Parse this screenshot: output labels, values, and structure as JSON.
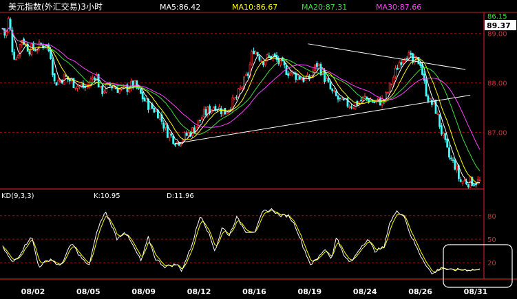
{
  "chart_data": [
    {
      "type": "candlestick",
      "title": "美元指数(外汇交易)3小时",
      "moving_averages": [
        {
          "name": "MA5",
          "value": "86.42",
          "color": "#ffffff"
        },
        {
          "name": "MA10",
          "value": "86.67",
          "color": "#ffff00"
        },
        {
          "name": "MA20",
          "value": "87.31",
          "color": "#40e040"
        },
        {
          "name": "MA30",
          "value": "87.66",
          "color": "#ff40ff"
        }
      ],
      "y_ticks": [
        "89.00",
        "88.00",
        "87.00"
      ],
      "ylim": [
        85.85,
        89.4
      ],
      "price_labels": {
        "high": "86.15",
        "current": "89.37"
      },
      "x_ticks": [
        "08/02",
        "08/05",
        "08/09",
        "08/12",
        "08/16",
        "08/19",
        "08/24",
        "08/26",
        "08/31"
      ],
      "up_color": "#ff3030",
      "down_color": "#40ffff",
      "trendlines": [
        {
          "from": [
            0.64,
            88.79
          ],
          "to": [
            0.97,
            88.27
          ]
        },
        {
          "from": [
            0.36,
            86.77
          ],
          "to": [
            0.98,
            87.75
          ]
        }
      ],
      "anchors": [
        [
          0.0,
          89.1
        ],
        [
          0.006,
          88.92
        ],
        [
          0.013,
          89.33
        ],
        [
          0.02,
          88.7
        ],
        [
          0.027,
          88.46
        ],
        [
          0.04,
          88.9
        ],
        [
          0.055,
          88.68
        ],
        [
          0.07,
          88.7
        ],
        [
          0.088,
          88.8
        ],
        [
          0.1,
          88.6
        ],
        [
          0.108,
          88.0
        ],
        [
          0.13,
          88.12
        ],
        [
          0.155,
          87.95
        ],
        [
          0.175,
          87.9
        ],
        [
          0.195,
          88.2
        ],
        [
          0.205,
          87.82
        ],
        [
          0.225,
          87.95
        ],
        [
          0.25,
          87.85
        ],
        [
          0.275,
          87.97
        ],
        [
          0.3,
          87.6
        ],
        [
          0.325,
          87.4
        ],
        [
          0.345,
          87.0
        ],
        [
          0.365,
          86.8
        ],
        [
          0.38,
          86.9
        ],
        [
          0.4,
          87.05
        ],
        [
          0.42,
          87.35
        ],
        [
          0.445,
          87.55
        ],
        [
          0.465,
          87.4
        ],
        [
          0.49,
          87.7
        ],
        [
          0.505,
          88.0
        ],
        [
          0.515,
          88.2
        ],
        [
          0.525,
          88.7
        ],
        [
          0.545,
          88.45
        ],
        [
          0.565,
          88.55
        ],
        [
          0.58,
          88.4
        ],
        [
          0.595,
          88.25
        ],
        [
          0.615,
          88.15
        ],
        [
          0.64,
          88.05
        ],
        [
          0.66,
          88.4
        ],
        [
          0.675,
          88.1
        ],
        [
          0.69,
          87.8
        ],
        [
          0.71,
          87.6
        ],
        [
          0.735,
          87.55
        ],
        [
          0.76,
          87.7
        ],
        [
          0.78,
          87.6
        ],
        [
          0.8,
          87.65
        ],
        [
          0.815,
          88.0
        ],
        [
          0.83,
          88.4
        ],
        [
          0.845,
          88.62
        ],
        [
          0.86,
          88.4
        ],
        [
          0.875,
          88.45
        ],
        [
          0.885,
          87.9
        ],
        [
          0.895,
          87.6
        ],
        [
          0.905,
          87.55
        ],
        [
          0.92,
          87.0
        ],
        [
          0.935,
          86.5
        ],
        [
          0.95,
          86.3
        ],
        [
          0.958,
          86.0
        ]
      ]
    },
    {
      "type": "line",
      "indicator": "KD(9,3,3)",
      "k_label": "K:10.95",
      "d_label": "D:11.96",
      "y_ticks": [
        "80",
        "50",
        "20"
      ],
      "ylim": [
        0,
        100
      ],
      "series": [
        {
          "name": "K",
          "color": "#ffffff"
        },
        {
          "name": "D",
          "color": "#ffff00"
        }
      ],
      "anchors": [
        [
          0.0,
          40
        ],
        [
          0.02,
          20
        ],
        [
          0.035,
          30
        ],
        [
          0.06,
          55
        ],
        [
          0.075,
          15
        ],
        [
          0.1,
          25
        ],
        [
          0.12,
          15
        ],
        [
          0.145,
          45
        ],
        [
          0.16,
          30
        ],
        [
          0.18,
          15
        ],
        [
          0.2,
          65
        ],
        [
          0.215,
          85
        ],
        [
          0.225,
          72
        ],
        [
          0.24,
          50
        ],
        [
          0.255,
          60
        ],
        [
          0.27,
          45
        ],
        [
          0.29,
          22
        ],
        [
          0.305,
          52
        ],
        [
          0.32,
          25
        ],
        [
          0.34,
          15
        ],
        [
          0.365,
          18
        ],
        [
          0.375,
          10
        ],
        [
          0.395,
          40
        ],
        [
          0.415,
          82
        ],
        [
          0.43,
          60
        ],
        [
          0.445,
          35
        ],
        [
          0.46,
          65
        ],
        [
          0.475,
          55
        ],
        [
          0.49,
          78
        ],
        [
          0.51,
          60
        ],
        [
          0.53,
          60
        ],
        [
          0.545,
          85
        ],
        [
          0.565,
          88
        ],
        [
          0.58,
          80
        ],
        [
          0.6,
          80
        ],
        [
          0.615,
          65
        ],
        [
          0.63,
          40
        ],
        [
          0.645,
          18
        ],
        [
          0.66,
          25
        ],
        [
          0.675,
          38
        ],
        [
          0.69,
          25
        ],
        [
          0.7,
          55
        ],
        [
          0.715,
          28
        ],
        [
          0.73,
          20
        ],
        [
          0.75,
          40
        ],
        [
          0.765,
          50
        ],
        [
          0.78,
          35
        ],
        [
          0.8,
          40
        ],
        [
          0.81,
          70
        ],
        [
          0.825,
          85
        ],
        [
          0.84,
          82
        ],
        [
          0.855,
          55
        ],
        [
          0.875,
          30
        ],
        [
          0.89,
          15
        ],
        [
          0.9,
          5
        ],
        [
          0.92,
          15
        ],
        [
          0.935,
          10
        ],
        [
          0.945,
          11
        ]
      ]
    }
  ],
  "highlight_note": "oversold box"
}
